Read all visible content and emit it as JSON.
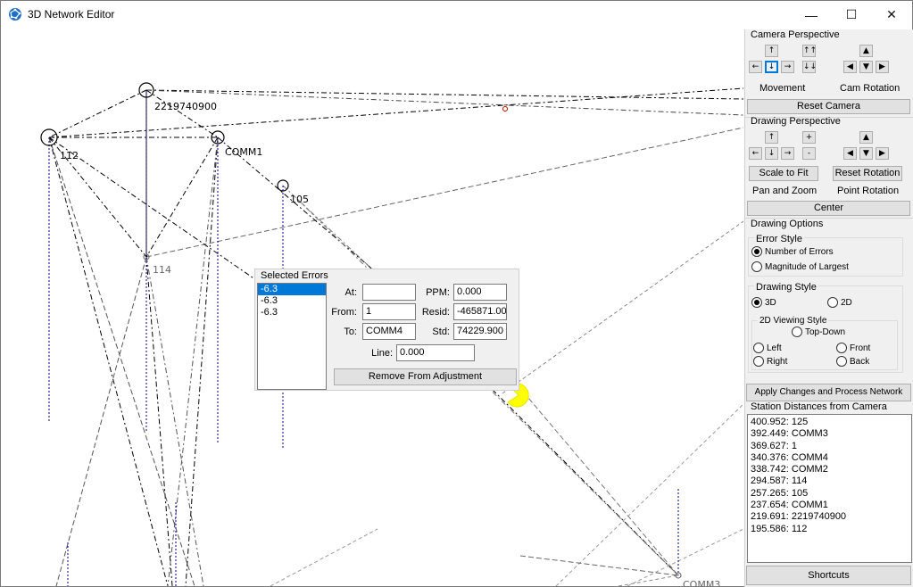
{
  "window": {
    "title": "3D Network Editor",
    "minimize": "—",
    "maximize": "☐",
    "close": "✕"
  },
  "stations": {
    "s2219740900": "2219740900",
    "s112": "112",
    "comm1": "COMM1",
    "s105": "105",
    "s114": "114",
    "comm_bottom": "COMM3"
  },
  "camera": {
    "title": "Camera Perspective",
    "up": "↑",
    "down": "↓",
    "left": "←",
    "right": "→",
    "up2": "↑↑",
    "down2": "↓↓",
    "rot_up": "▲",
    "rot_down": "▼",
    "rot_left": "◀",
    "rot_right": "▶",
    "movement_label": "Movement",
    "rotation_label": "Cam Rotation",
    "reset": "Reset Camera"
  },
  "drawing_perspective": {
    "title": "Drawing Perspective",
    "up": "↑",
    "down": "↓",
    "left": "←",
    "right": "→",
    "plus": "+",
    "minus": "-",
    "rot_up": "▲",
    "rot_down": "▼",
    "rot_left": "◀",
    "rot_right": "▶",
    "scale_to_fit": "Scale to Fit",
    "reset_rotation": "Reset Rotation",
    "pan_zoom_label": "Pan and Zoom",
    "point_rotation_label": "Point Rotation",
    "center": "Center"
  },
  "drawing_options": {
    "title": "Drawing Options",
    "error_style": {
      "title": "Error Style",
      "num_errors": "Number of Errors",
      "magnitude": "Magnitude of Largest",
      "selected": "num_errors"
    },
    "drawing_style": {
      "title": "Drawing Style",
      "opt_3d": "3D",
      "opt_2d": "2D",
      "selected": "3d"
    },
    "viewing_style": {
      "title": "2D Viewing Style",
      "top_down": "Top-Down",
      "left": "Left",
      "front": "Front",
      "right": "Right",
      "back": "Back"
    },
    "apply": "Apply Changes and Process Network"
  },
  "station_distances": {
    "title": "Station Distances from Camera",
    "items": [
      "400.952: 125",
      "392.449: COMM3",
      "369.627: 1",
      "340.376: COMM4",
      "338.742: COMM2",
      "294.587: 114",
      "257.265: 105",
      "237.654: COMM1",
      "219.691: 2219740900",
      "195.586: 112"
    ]
  },
  "shortcuts": "Shortcuts",
  "selected_errors": {
    "title": "Selected Errors",
    "errors": [
      "-6.3",
      "-6.3",
      "-6.3"
    ],
    "selected_index": 0,
    "at_label": "At:",
    "at_value": "",
    "from_label": "From:",
    "from_value": "1",
    "to_label": "To:",
    "to_value": "COMM4",
    "ppm_label": "PPM:",
    "ppm_value": "0.000",
    "resid_label": "Resid:",
    "resid_value": "-465871.00",
    "std_label": "Std:",
    "std_value": "74229.900",
    "line_label": "Line:",
    "line_value": "0.000",
    "remove": "Remove From Adjustment"
  },
  "colors": {
    "highlight": "#0078d7",
    "marker": "#ffff00",
    "vertical_line": "#00008b"
  }
}
